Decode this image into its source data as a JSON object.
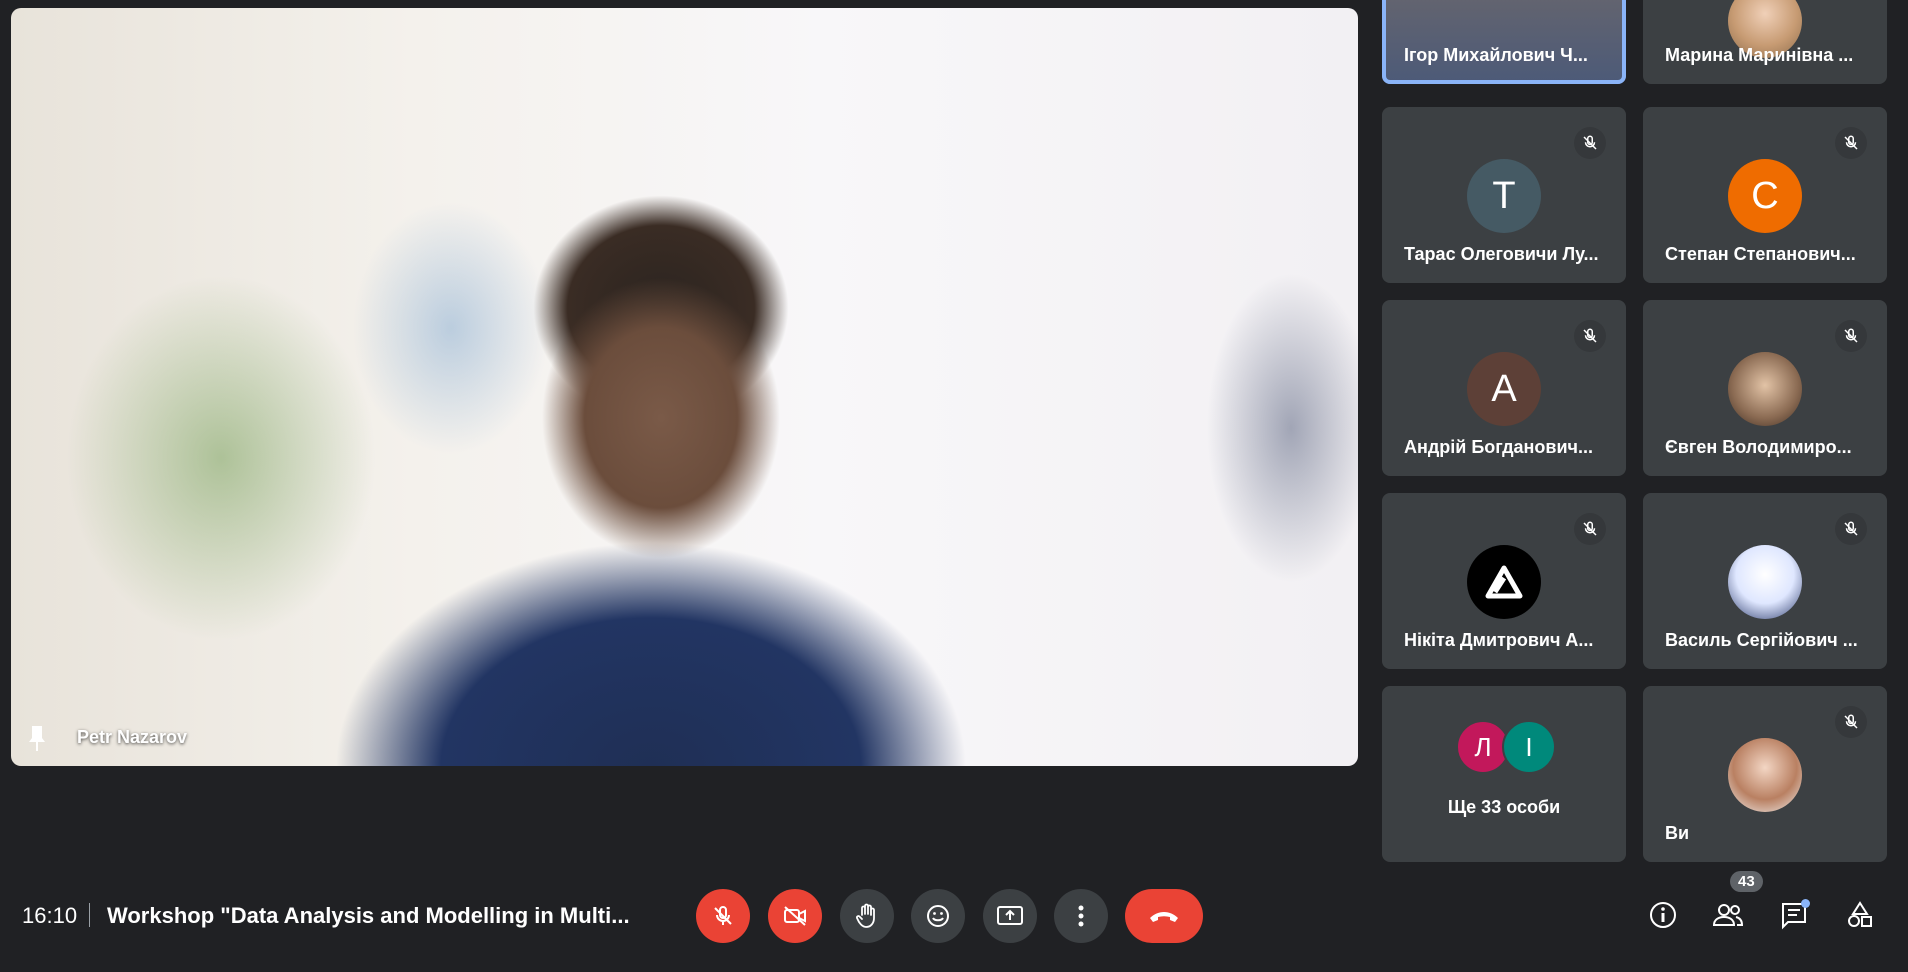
{
  "main": {
    "speaker_name": "Petr Nazarov"
  },
  "tiles": [
    {
      "name": "Ігор Михайлович Ч...",
      "type": "video",
      "active": true
    },
    {
      "name": "Марина Маринівна ...",
      "type": "photo"
    },
    {
      "name": "Тарас Олеговичи Лу...",
      "initial": "T",
      "color": "#455a64"
    },
    {
      "name": "Степан Степанович...",
      "initial": "C",
      "color": "#ef6c00"
    },
    {
      "name": "Андрій Богданович...",
      "initial": "A",
      "color": "#5d4037"
    },
    {
      "name": "Євген Володимиро...",
      "type": "photo"
    },
    {
      "name": "Нікіта Дмитрович А...",
      "type": "logo"
    },
    {
      "name": "Василь Сергійович ...",
      "type": "photo"
    },
    {
      "name": "Ще 33 особи",
      "initials": [
        "Л",
        "І"
      ]
    },
    {
      "name": "Ви",
      "type": "photo"
    }
  ],
  "bottom_bar": {
    "time": "16:10",
    "meeting_title": "Workshop \"Data Analysis and Modelling in Multi...",
    "participant_count": "43"
  },
  "colors": {
    "background": "#202124",
    "tile": "#3c4043",
    "danger": "#ea4335",
    "accent": "#8ab4f8"
  }
}
